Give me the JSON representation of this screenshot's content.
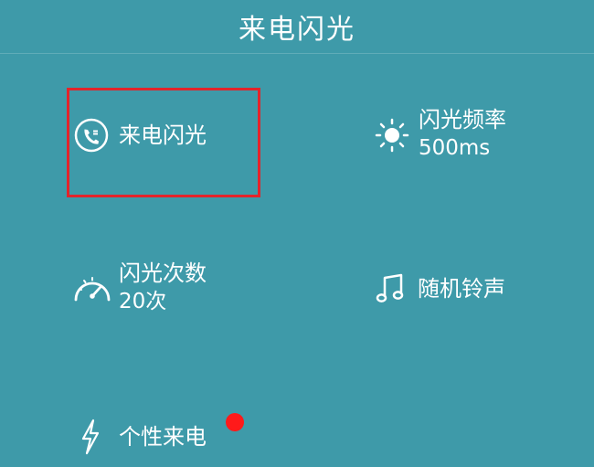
{
  "header": {
    "title": "来电闪光"
  },
  "tiles": {
    "incoming_flash": {
      "label": "来电闪光",
      "icon": "phone-circle-icon"
    },
    "flash_frequency": {
      "label": "闪光频率",
      "value": "500ms",
      "icon": "sun-icon"
    },
    "flash_count": {
      "label": "闪光次数",
      "value": "20次",
      "icon": "speedometer-icon"
    },
    "random_ringtone": {
      "label": "随机铃声",
      "icon": "music-note-icon"
    },
    "personalized_call": {
      "label": "个性来电",
      "icon": "lightning-icon",
      "badge": "red-dot"
    }
  },
  "colors": {
    "background": "#3e9aa9",
    "highlight": "#e3242b",
    "badge": "#ff1a1a",
    "text": "#ffffff"
  }
}
